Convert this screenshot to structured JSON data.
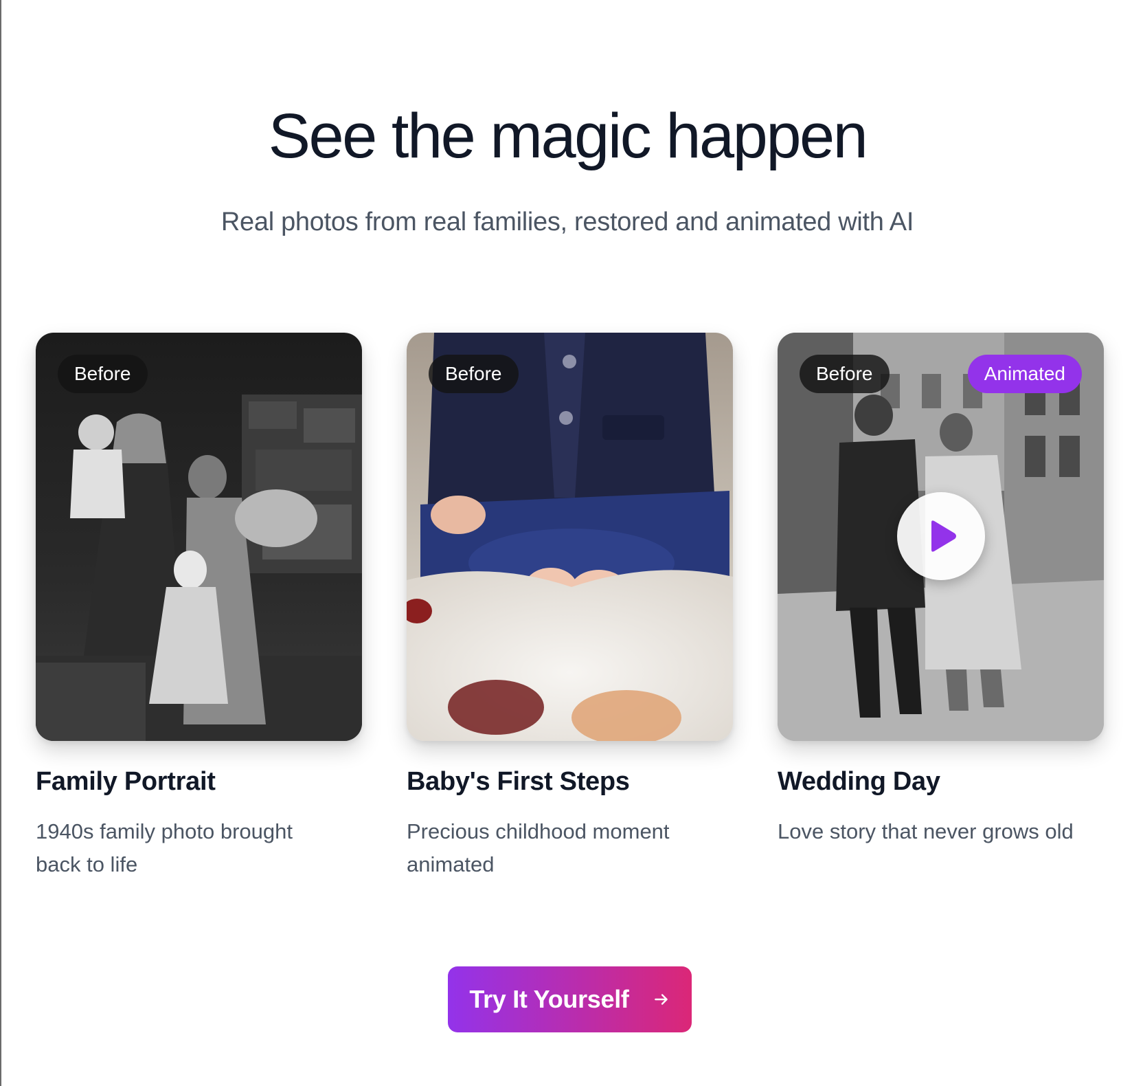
{
  "hero": {
    "title": "See the magic happen",
    "subtitle": "Real photos from real families, restored and animated with AI"
  },
  "cards": [
    {
      "badge_before": "Before",
      "title": "Family Portrait",
      "description": "1940s family photo brought back to life"
    },
    {
      "badge_before": "Before",
      "title": "Baby's First Steps",
      "description": "Precious childhood moment animated"
    },
    {
      "badge_before": "Before",
      "badge_animated": "Animated",
      "title": "Wedding Day",
      "description": "Love story that never grows old"
    }
  ],
  "cta": {
    "label": "Try It Yourself",
    "icon": "arrow-right-icon"
  },
  "colors": {
    "accent_purple": "#9333ea",
    "accent_pink": "#db2777",
    "heading": "#111827",
    "body_text": "#4b5563"
  }
}
